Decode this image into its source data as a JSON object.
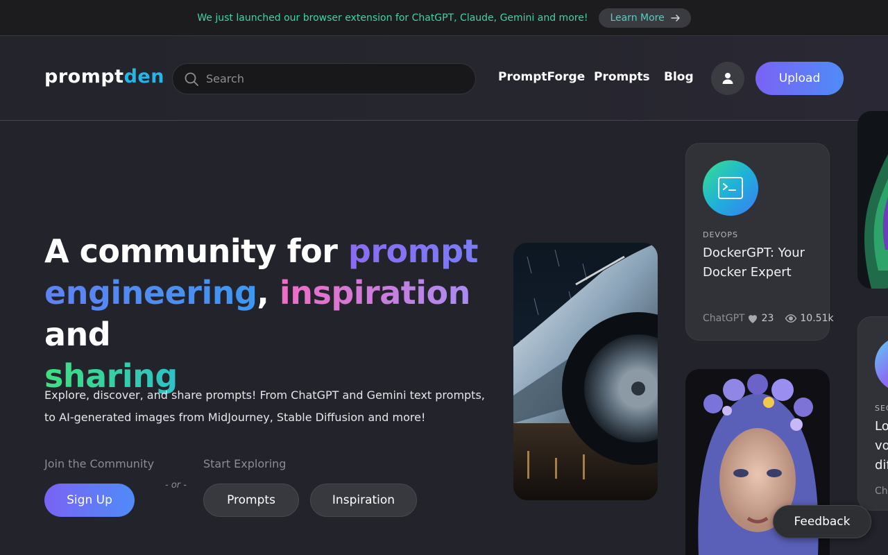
{
  "announcement": {
    "text": "We just launched our browser extension for ChatGPT, Claude, Gemini and more!",
    "cta_label": "Learn More"
  },
  "header": {
    "logo_part1": "prompt",
    "logo_part2": "den",
    "search_placeholder": "Search",
    "nav": [
      {
        "label": "PromptForge"
      },
      {
        "label": "Prompts"
      },
      {
        "label": "Blog"
      }
    ],
    "upload_label": "Upload"
  },
  "hero": {
    "title_plain1": "A community for ",
    "title_accent1": "prompt",
    "title_accent2": "engineering",
    "title_comma": ",",
    "title_accent3": "inspiration",
    "title_plain2": " and",
    "title_accent4": "sharing",
    "description": "Explore, discover, and share prompts! From ChatGPT and Gemini text prompts, to AI-generated images from MidJourney, Stable Diffusion and more!",
    "join_label": "Join the Community",
    "explore_label": "Start Exploring",
    "or_label": "- or -",
    "signup_label": "Sign Up",
    "prompts_label": "Prompts",
    "inspiration_label": "Inspiration"
  },
  "cards": {
    "prompt_card": {
      "category": "DEVOPS",
      "title": "DockerGPT: Your Docker Expert",
      "model": "ChatGPT",
      "likes": "23",
      "views": "10.51k"
    },
    "peek_card": {
      "category": "SEC",
      "title": "Lo\nvo\ndif",
      "model": "Cha"
    }
  },
  "feedback_label": "Feedback",
  "colors": {
    "accent_gradient_start": "#7a63f5",
    "accent_gradient_end": "#4f8bf7",
    "announcement_text": "#3fd4a5",
    "logo_accent": "#25b6e6"
  }
}
